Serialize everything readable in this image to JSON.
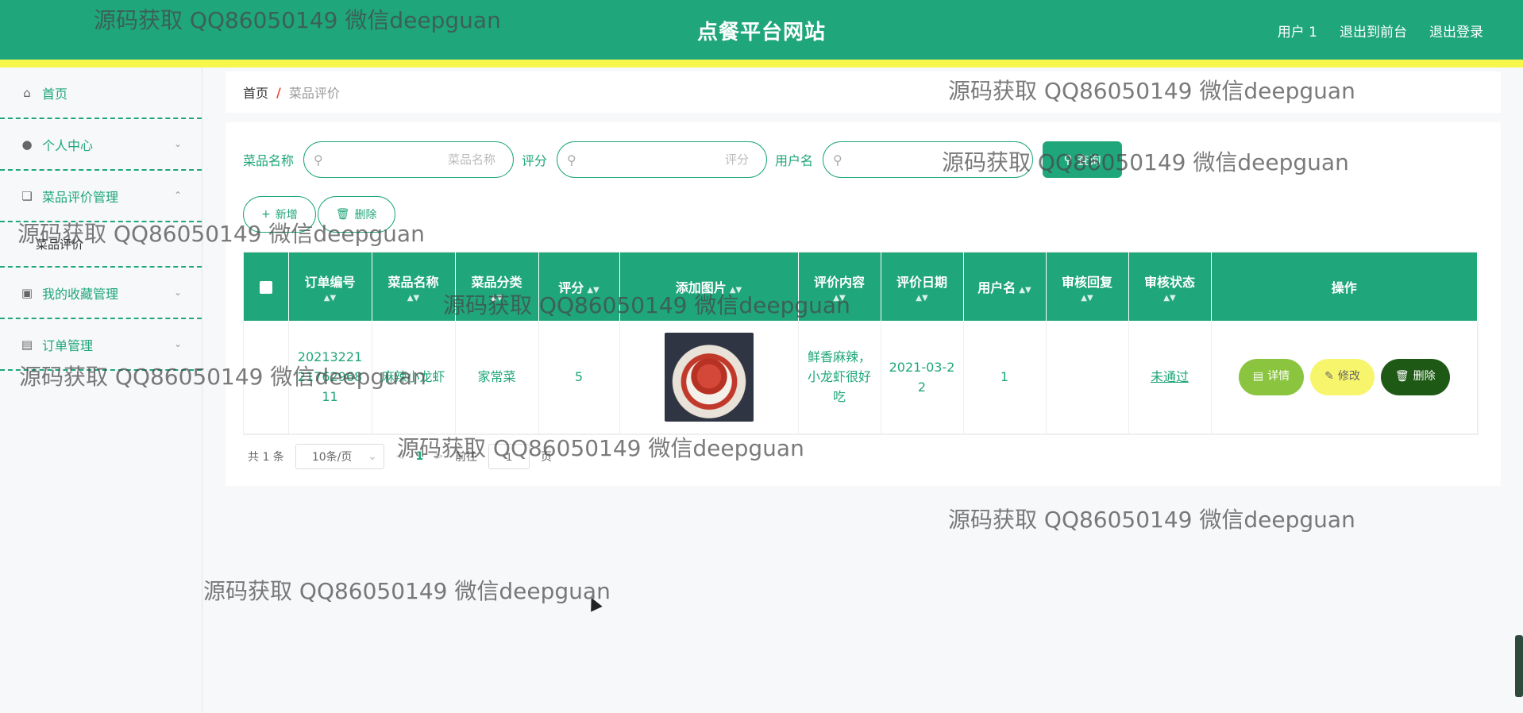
{
  "header": {
    "title": "点餐平台网站",
    "links": [
      "用户 1",
      "退出到前台",
      "退出登录"
    ]
  },
  "sidebar": {
    "items": [
      {
        "label": "首页",
        "icon": "home-icon",
        "arrow": ""
      },
      {
        "label": "个人中心",
        "icon": "user-icon",
        "arrow": "chevron-down-icon"
      },
      {
        "label": "菜品评价管理",
        "icon": "crop-icon",
        "arrow": "chevron-up-icon"
      },
      {
        "label": "菜品评价",
        "submenu": true
      },
      {
        "label": "我的收藏管理",
        "icon": "collect-icon",
        "arrow": "chevron-down-icon"
      },
      {
        "label": "订单管理",
        "icon": "order-icon",
        "arrow": "chevron-down-icon"
      }
    ]
  },
  "breadcrumb": {
    "home": "首页",
    "separator": "/",
    "current": "菜品评价"
  },
  "search": {
    "fields": [
      {
        "label": "菜品名称",
        "placeholder": "菜品名称"
      },
      {
        "label": "评分",
        "placeholder": "评分"
      },
      {
        "label": "用户名",
        "placeholder": ""
      }
    ],
    "button": "查询"
  },
  "actions": {
    "add": "新增",
    "delete": "删除"
  },
  "table": {
    "headers": [
      "订单编号",
      "菜品名称",
      "菜品分类",
      "评分",
      "添加图片",
      "评价内容",
      "评价日期",
      "用户名",
      "审核回复",
      "审核状态",
      "操作"
    ],
    "rows": [
      {
        "order_no": "202132212176296811",
        "dish_name": "麻辣小龙虾",
        "category": "家常菜",
        "rating": "5",
        "image": "crayfish-dish-image",
        "review": "鲜香麻辣，小龙虾很好吃",
        "date": "2021-03-22",
        "user": "1",
        "reply": "",
        "status": "未通过"
      }
    ],
    "row_actions": {
      "detail": "详情",
      "edit": "修改",
      "delete": "删除"
    }
  },
  "pagination": {
    "total": "共 1 条",
    "page_size": "10条/页",
    "current_page": "1",
    "goto_prefix": "前往",
    "goto_value": "1",
    "goto_suffix": "页"
  },
  "watermark": "源码获取 QQ86050149 微信deepguan",
  "colors": {
    "primary": "#1fa67a",
    "stripe": "#f5f74a",
    "detail_btn": "#8bc53f",
    "edit_btn": "#f7f56b",
    "delete_btn": "#1e5a16"
  }
}
